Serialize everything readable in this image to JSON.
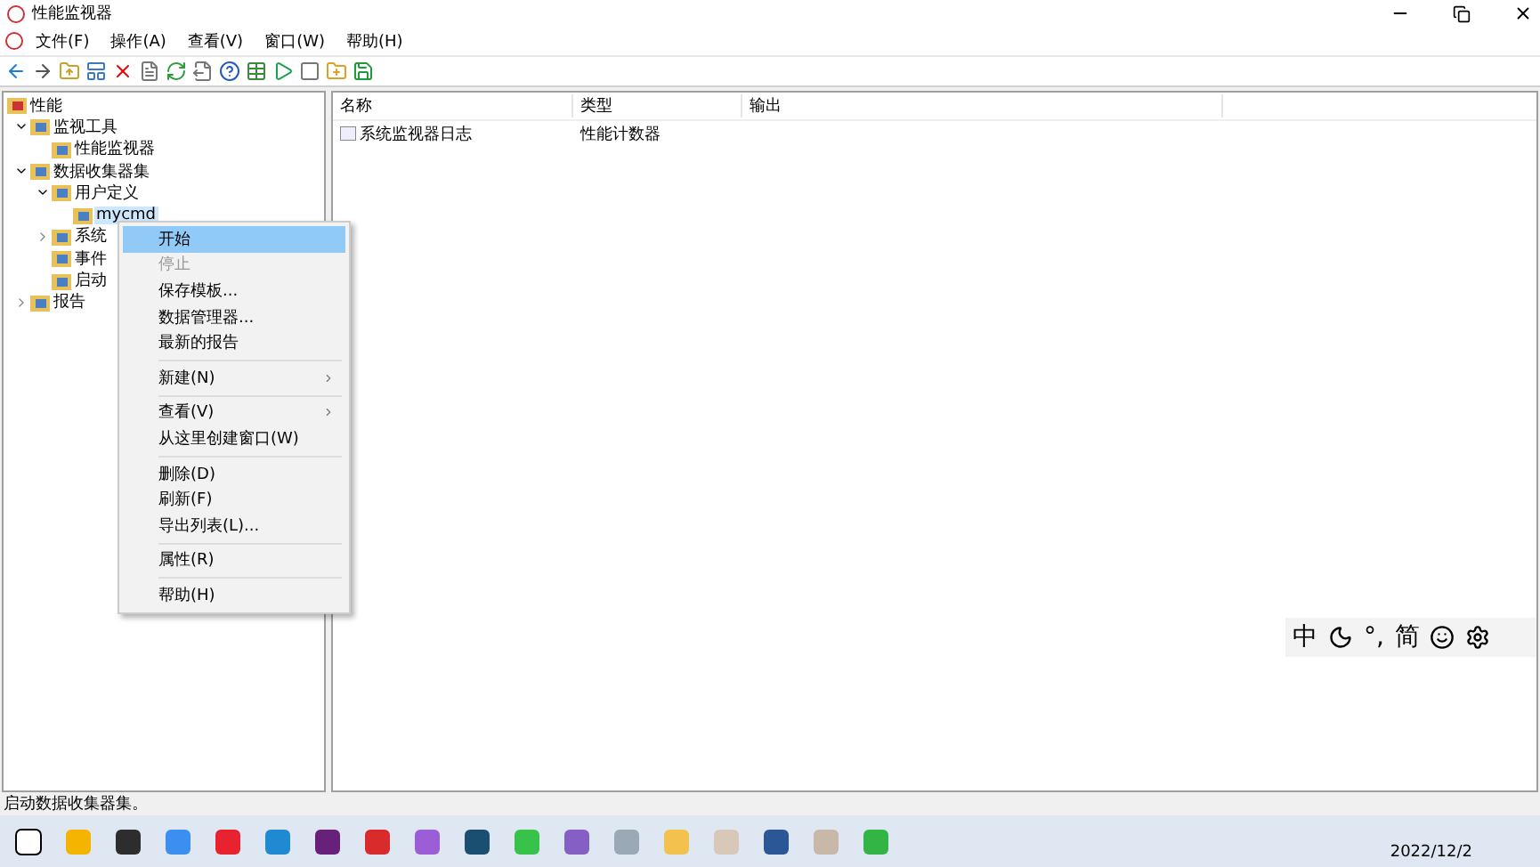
{
  "window": {
    "title": "性能监视器"
  },
  "menubar": [
    {
      "label": "文件(F)"
    },
    {
      "label": "操作(A)"
    },
    {
      "label": "查看(V)"
    },
    {
      "label": "窗口(W)"
    },
    {
      "label": "帮助(H)"
    }
  ],
  "tree": [
    {
      "label": "性能",
      "children": [
        {
          "label": "监视工具",
          "expanded": true,
          "children": [
            {
              "label": "性能监视器"
            }
          ]
        },
        {
          "label": "数据收集器集",
          "expanded": true,
          "children": [
            {
              "label": "用户定义",
              "expanded": true,
              "children": [
                {
                  "label": "mycmd",
                  "selected": true
                }
              ]
            },
            {
              "label": "系统",
              "expanded": false
            },
            {
              "label": "事件"
            },
            {
              "label": "启动"
            }
          ]
        },
        {
          "label": "报告",
          "expanded": false
        }
      ]
    }
  ],
  "list": {
    "columns": [
      "名称",
      "类型",
      "输出"
    ],
    "rows": [
      {
        "name": "系统监视器日志",
        "type": "性能计数器"
      }
    ]
  },
  "context_menu": {
    "groups": [
      [
        {
          "label": "开始",
          "selected": true,
          "disabled": false
        },
        {
          "label": "停止",
          "selected": false,
          "disabled": true
        },
        {
          "label": "保存模板...",
          "selected": false,
          "disabled": false
        },
        {
          "label": "数据管理器...",
          "selected": false,
          "disabled": false
        },
        {
          "label": "最新的报告",
          "selected": false,
          "disabled": false
        }
      ],
      [
        {
          "label": "新建(N)",
          "selected": false,
          "disabled": false,
          "submenu": true
        }
      ],
      [
        {
          "label": "查看(V)",
          "selected": false,
          "disabled": false,
          "submenu": true
        },
        {
          "label": "从这里创建窗口(W)",
          "selected": false,
          "disabled": false
        }
      ],
      [
        {
          "label": "删除(D)",
          "selected": false,
          "disabled": false
        },
        {
          "label": "刷新(F)",
          "selected": false,
          "disabled": false
        },
        {
          "label": "导出列表(L)...",
          "selected": false,
          "disabled": false
        }
      ],
      [
        {
          "label": "属性(R)",
          "selected": false,
          "disabled": false
        }
      ],
      [
        {
          "label": "帮助(H)",
          "selected": false,
          "disabled": false
        }
      ]
    ]
  },
  "ime_bar": [
    "中",
    "°,",
    "简"
  ],
  "status_bar": "启动数据收集器集。",
  "taskbar": {
    "date": "2022/12/2"
  }
}
